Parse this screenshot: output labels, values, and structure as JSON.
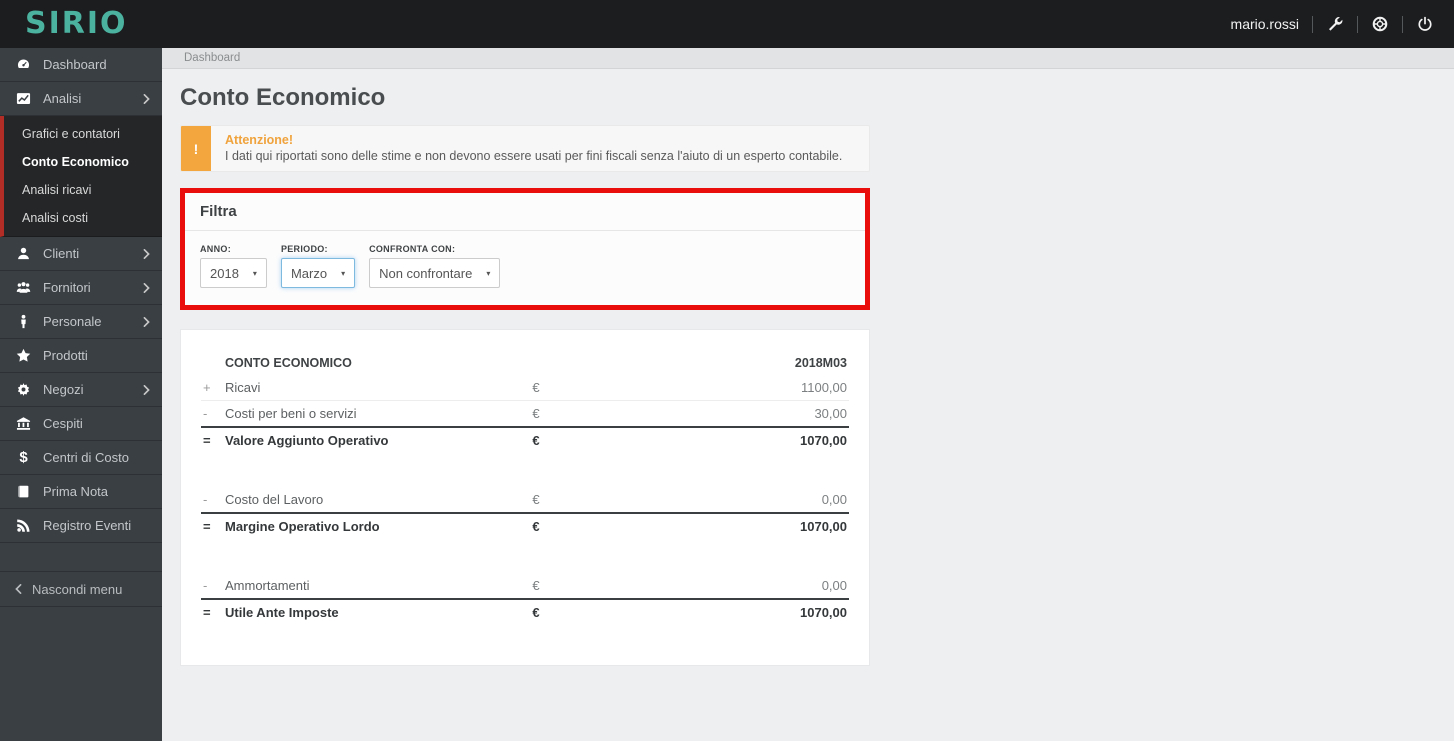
{
  "topbar": {
    "brand": "SIRIO",
    "username": "mario.rossi",
    "icons": [
      "wrench-icon",
      "lifering-icon",
      "power-icon"
    ]
  },
  "sidebar": {
    "items": [
      {
        "label": "Dashboard",
        "icon": "dashboard-icon",
        "chevron": false,
        "expanded": false
      },
      {
        "label": "Analisi",
        "icon": "chart-icon",
        "chevron": true,
        "expanded": true
      },
      {
        "label": "Clienti",
        "icon": "user-icon",
        "chevron": true,
        "expanded": false
      },
      {
        "label": "Fornitori",
        "icon": "users-icon",
        "chevron": true,
        "expanded": false
      },
      {
        "label": "Personale",
        "icon": "person-icon",
        "chevron": true,
        "expanded": false
      },
      {
        "label": "Prodotti",
        "icon": "star-icon",
        "chevron": false,
        "expanded": false
      },
      {
        "label": "Negozi",
        "icon": "gear-icon",
        "chevron": true,
        "expanded": false
      },
      {
        "label": "Cespiti",
        "icon": "bank-icon",
        "chevron": false,
        "expanded": false
      },
      {
        "label": "Centri di Costo",
        "icon": "dollar-icon",
        "chevron": false,
        "expanded": false
      },
      {
        "label": "Prima Nota",
        "icon": "book-icon",
        "chevron": false,
        "expanded": false
      },
      {
        "label": "Registro Eventi",
        "icon": "rss-icon",
        "chevron": false,
        "expanded": false
      }
    ],
    "submenu": {
      "parent": "Analisi",
      "items": [
        {
          "label": "Grafici e contatori",
          "active": false
        },
        {
          "label": "Conto Economico",
          "active": true
        },
        {
          "label": "Analisi ricavi",
          "active": false
        },
        {
          "label": "Analisi costi",
          "active": false
        }
      ]
    },
    "collapse_label": "Nascondi menu"
  },
  "breadcrumb": "Dashboard",
  "page": {
    "title": "Conto Economico"
  },
  "alert": {
    "icon": "exclamation-icon",
    "title": "Attenzione!",
    "text": "I dati qui riportati sono delle stime e non devono essere usati per fini fiscali senza l'aiuto di un esperto contabile."
  },
  "filter": {
    "title": "Filtra",
    "fields": [
      {
        "label": "ANNO:",
        "value": "2018",
        "focused": false
      },
      {
        "label": "PERIODO:",
        "value": "Marzo",
        "focused": true
      },
      {
        "label": "CONFRONTA CON:",
        "value": "Non confrontare",
        "focused": false
      }
    ]
  },
  "table": {
    "title": "CONTO ECONOMICO",
    "period": "2018M03",
    "currency": "€",
    "rows": [
      {
        "type": "normal",
        "sign": "+",
        "label": "Ricavi",
        "value": "1100,00"
      },
      {
        "type": "normal",
        "sign": "-",
        "label": "Costi per beni o servizi",
        "value": "30,00"
      },
      {
        "type": "total",
        "sign": "=",
        "label": "Valore Aggiunto Operativo",
        "value": "1070,00"
      },
      {
        "type": "spacer"
      },
      {
        "type": "normal",
        "sign": "-",
        "label": "Costo del Lavoro",
        "value": "0,00"
      },
      {
        "type": "total",
        "sign": "=",
        "label": "Margine Operativo Lordo",
        "value": "1070,00"
      },
      {
        "type": "spacer"
      },
      {
        "type": "normal",
        "sign": "-",
        "label": "Ammortamenti",
        "value": "0,00"
      },
      {
        "type": "total",
        "sign": "=",
        "label": "Utile Ante Imposte",
        "value": "1070,00"
      }
    ]
  },
  "colors": {
    "brand_teal": "#4cb2a0",
    "topbar_bg": "#1b1d1f",
    "sidebar_bg": "#3a3f44",
    "submenu_accent_red": "#b22d26",
    "alert_orange": "#f2a63d",
    "highlight_red": "#e90d0c",
    "select_focus_blue": "#7eb9e0"
  }
}
